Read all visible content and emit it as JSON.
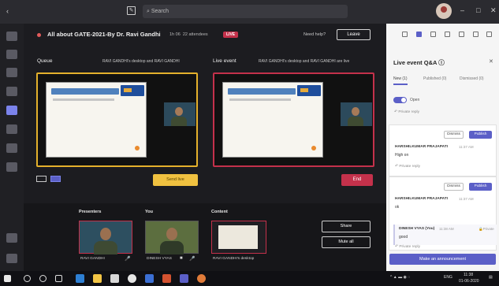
{
  "titlebar": {
    "search_placeholder": "Search",
    "back_glyph": "‹",
    "compose_glyph": "✎",
    "minimize_glyph": "–",
    "maximize_glyph": "□",
    "close_glyph": "✕"
  },
  "event": {
    "title": "All about GATE-2021-By Dr. Ravi Gandhi",
    "duration": "1h 06",
    "attendees": "22 attendees",
    "live_badge": "LIVE",
    "need_help": "Need help?",
    "leave_label": "Leave"
  },
  "queue": {
    "label": "Queue",
    "source": "RAVI GANDHI's desktop and RAVI GANDHI",
    "send_live_label": "Send live"
  },
  "live_event": {
    "label": "Live event",
    "source": "RAVI GANDHI's desktop and RAVI GANDHI are live",
    "end_label": "End"
  },
  "bottom": {
    "presenters_label": "Presenters",
    "you_label": "You",
    "content_label": "Content",
    "presenter_name": "RAVI GANDHI",
    "you_name": "DINESH VYAS",
    "content_name": "RAVI GANDHI's desktop",
    "share_label": "Share",
    "mute_all_label": "Mute all"
  },
  "qa": {
    "title": "Live event Q&A",
    "tabs": [
      {
        "label": "New (1)",
        "active": true
      },
      {
        "label": "Published (0)",
        "active": false
      },
      {
        "label": "Dismissed (0)",
        "active": false
      }
    ],
    "toggle_label": "Open",
    "private_reply": "Private reply",
    "questions": [
      {
        "author": "HARSHILKUMAR PRAJAPATI",
        "time": "11:37 AM",
        "text": "High on",
        "dismiss_label": "Dismiss",
        "publish_label": "Publish"
      },
      {
        "author": "HARSHILKUMAR PRAJAPATI",
        "time": "11:37 AM",
        "text": "ok",
        "dismiss_label": "Dismiss",
        "publish_label": "Publish",
        "reply_author": "DINESH VYAS (You)",
        "reply_time": "11:38 AM",
        "reply_tag": "Private",
        "reply_text": "good"
      }
    ],
    "announce_label": "Make an announcement"
  },
  "taskbar": {
    "time": "11:38",
    "date": "01-06-2020",
    "lang": "ENG"
  },
  "colors": {
    "accent": "#5b5fc7",
    "queue_border": "#e4b12c",
    "live_red": "#c4314b"
  }
}
